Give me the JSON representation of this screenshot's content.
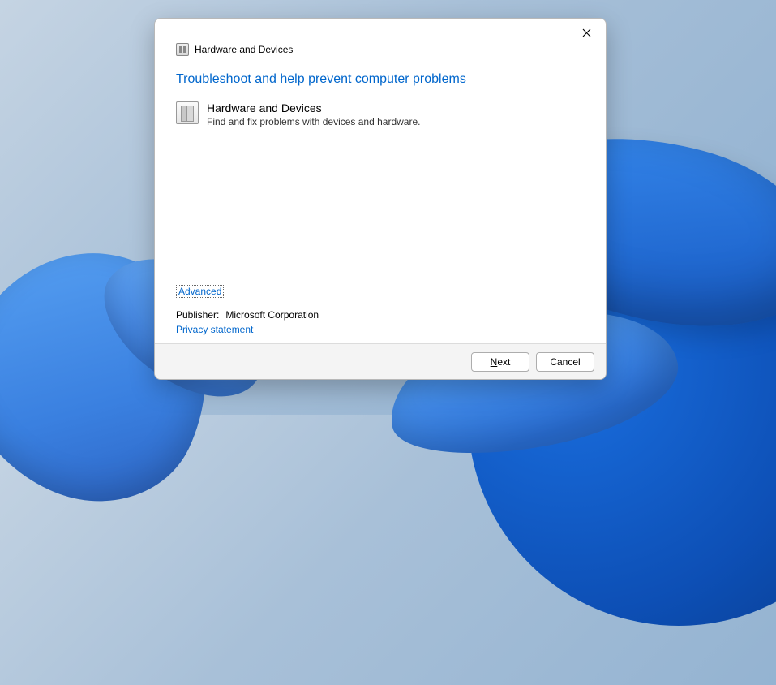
{
  "window": {
    "title": "Hardware and Devices"
  },
  "content": {
    "heading": "Troubleshoot and help prevent computer problems",
    "troubleshooter": {
      "title": "Hardware and Devices",
      "description": "Find and fix problems with devices and hardware."
    },
    "advanced_label": "Advanced",
    "publisher_label": "Publisher:",
    "publisher_value": "Microsoft Corporation",
    "privacy_label": "Privacy statement"
  },
  "footer": {
    "next_prefix": "N",
    "next_rest": "ext",
    "cancel_label": "Cancel"
  }
}
